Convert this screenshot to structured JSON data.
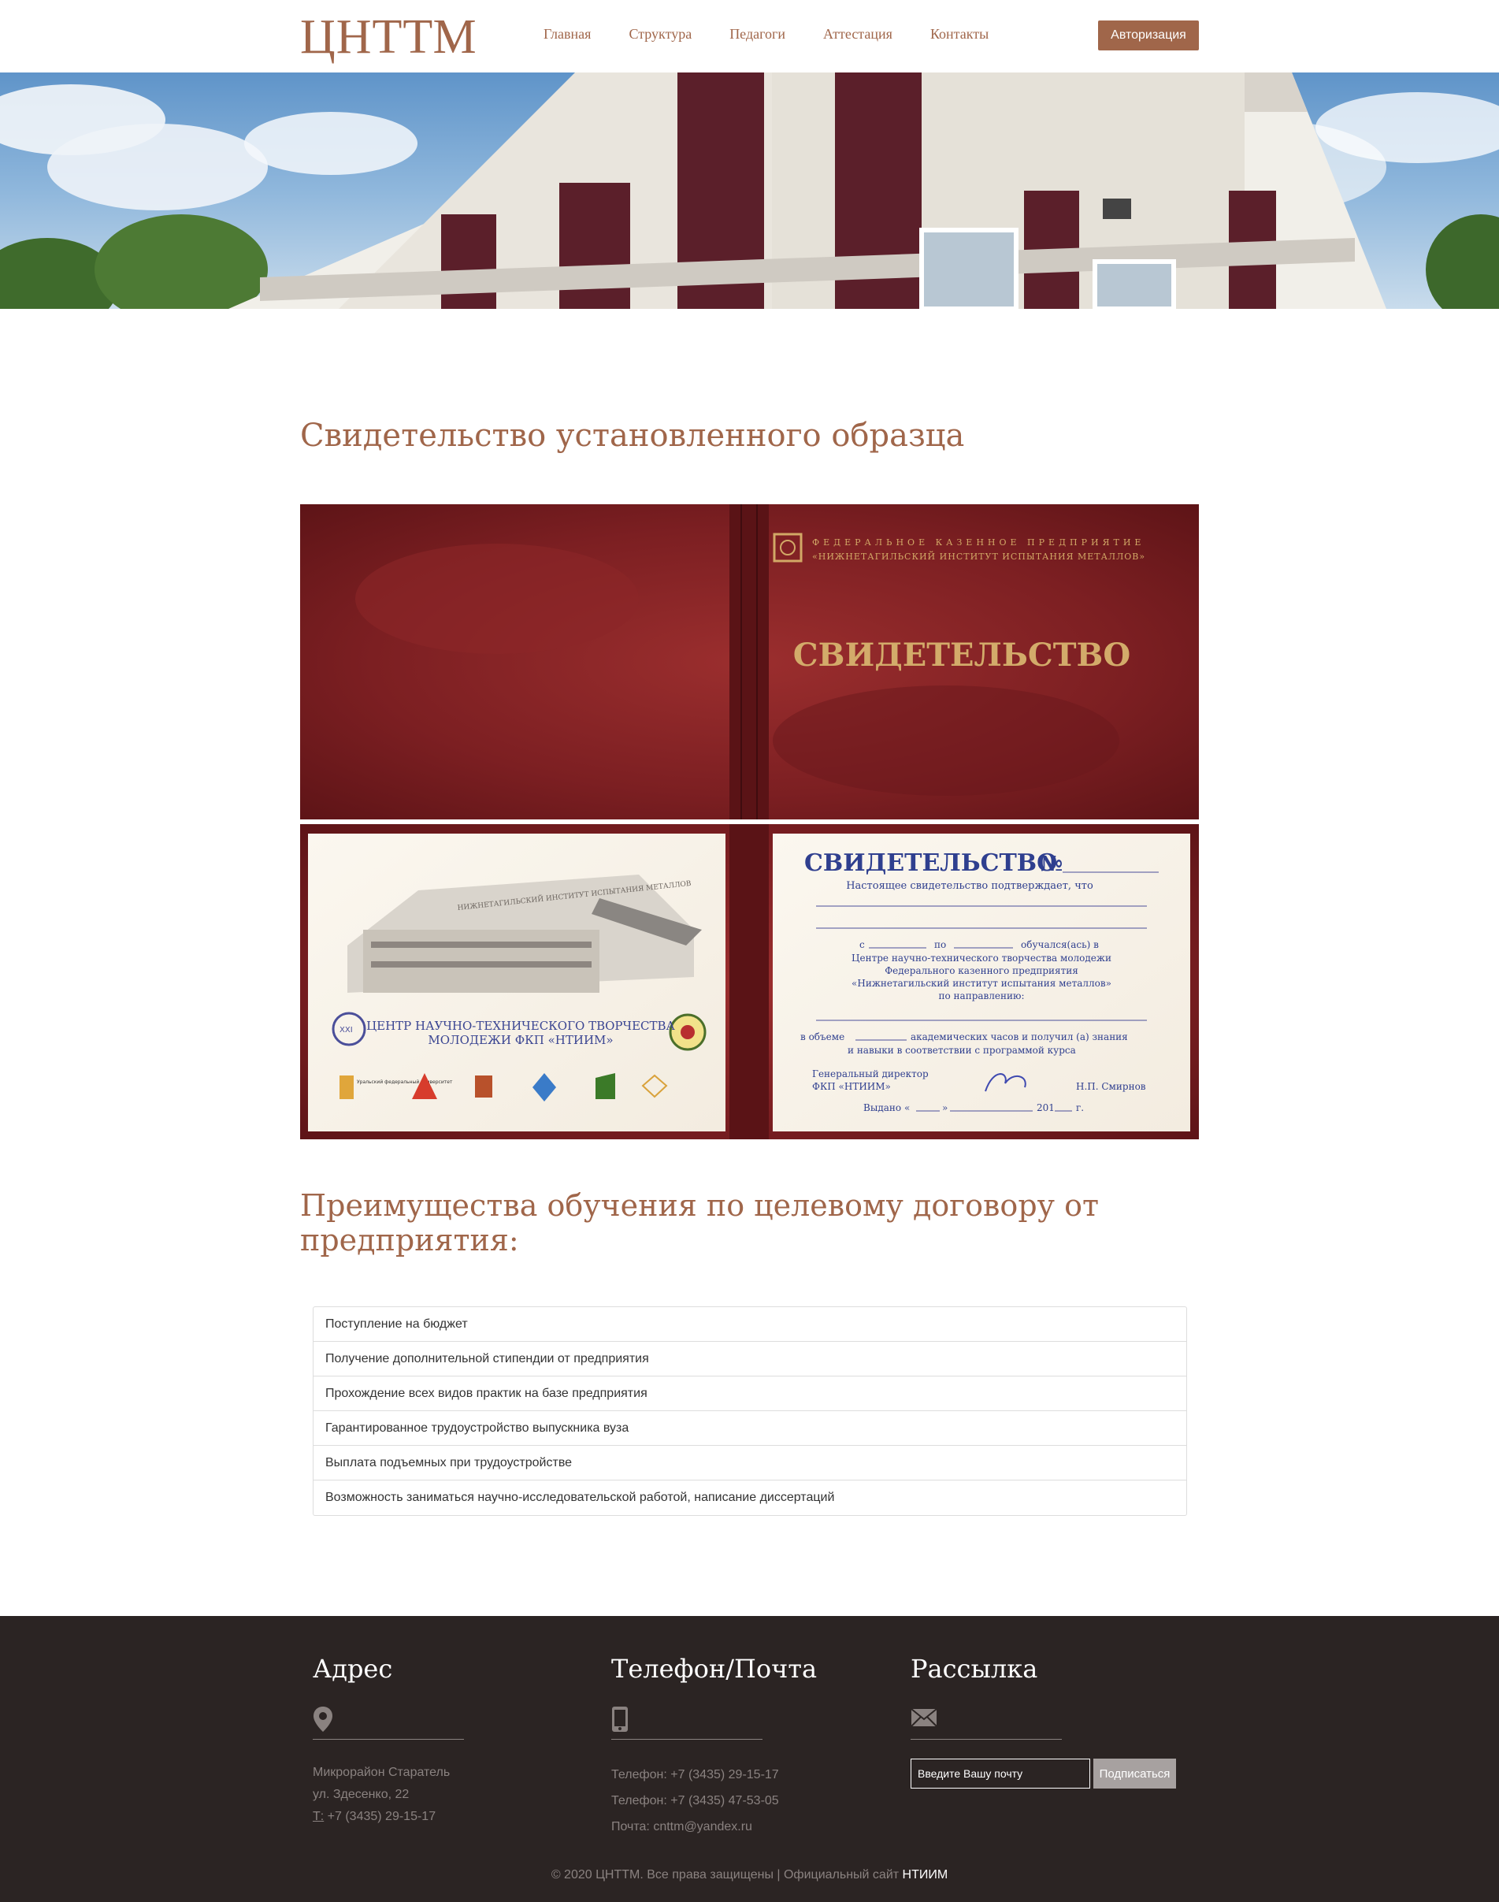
{
  "header": {
    "logo": "ЦНТТМ",
    "nav": [
      "Главная",
      "Структура",
      "Педагоги",
      "Аттестация",
      "Контакты"
    ],
    "auth_label": "Авторизация"
  },
  "main": {
    "title": "Свидетельство установленного образца",
    "certificate": {
      "cover_top": "ФЕДЕРАЛЬНОЕ КАЗЕННОЕ ПРЕДПРИЯТИЕ",
      "cover_org": "«НИЖНЕТАГИЛЬСКИЙ ИНСТИТУТ ИСПЫТАНИЯ МЕТАЛЛОВ»",
      "cover_title": "СВИДЕТЕЛЬСТВО",
      "left_building_text": "НИЖНЕТАГИЛЬСКИЙ ИНСТИТУТ ИСПЫТАНИЯ МЕТАЛЛОВ",
      "left_center_line1": "ЦЕНТР НАУЧНО-ТЕХНИЧЕСКОГО ТВОРЧЕСТВА",
      "left_center_line2": "МОЛОДЕЖИ ФКП «НТИИМ»",
      "left_logo_text": "Уральский федеральный университет",
      "right_title": "СВИДЕТЕЛЬСТВО",
      "right_number_sign": "№",
      "right_confirm": "Настоящее свидетельство подтверждает, что",
      "right_from": "с",
      "right_to": "по",
      "right_studied": "обучался(ась) в",
      "right_line1": "Центре научно-технического творчества молодежи",
      "right_line2": "Федерального казенного предприятия",
      "right_line3": "«Нижнетагильский институт испытания металлов»",
      "right_line4": "по направлению:",
      "right_volume_a": "в объеме",
      "right_volume_b": "академических часов и получил (а) знания",
      "right_volume_c": "и навыки в соответствии с программой курса",
      "right_director1": "Генеральный директор",
      "right_director2": "ФКП «НТИИМ»",
      "right_director_name": "Н.П. Смирнов",
      "right_issued": "Выдано «",
      "right_issued_b": "»",
      "right_year": "201",
      "right_year_suffix": "г."
    },
    "benefits_title": "Преимущества обучения по целевому договору от предприятия:",
    "benefits": [
      "Поступление на бюджет",
      "Получение дополнительной стипендии от предприятия",
      "Прохождение всех видов практик на базе предприятия",
      "Гарантированное трудоустройство выпускника вуза",
      "Выплата подъемных при трудоустройстве",
      "Возможность заниматься научно-исследовательской работой, написание диссертаций"
    ]
  },
  "footer": {
    "address": {
      "title": "Адрес",
      "lines": [
        "Микрорайон Старатель",
        "ул. Здесенко, 22"
      ],
      "phone_prefix": "Т:",
      "phone": " +7 (3435) 29-15-17"
    },
    "contacts": {
      "title": "Телефон/Почта",
      "lines": [
        "Телефон: +7 (3435) 29-15-17",
        "Телефон: +7 (3435) 47-53-05",
        "Почта: cnttm@yandex.ru"
      ]
    },
    "newsletter": {
      "title": "Рассылка",
      "placeholder": "Введите Вашу почту",
      "button": "Подписаться"
    },
    "copyright": "© 2020 ЦНТТМ. Все права защищены | Официальный сайт ",
    "copyright_link": "НТИИМ"
  }
}
